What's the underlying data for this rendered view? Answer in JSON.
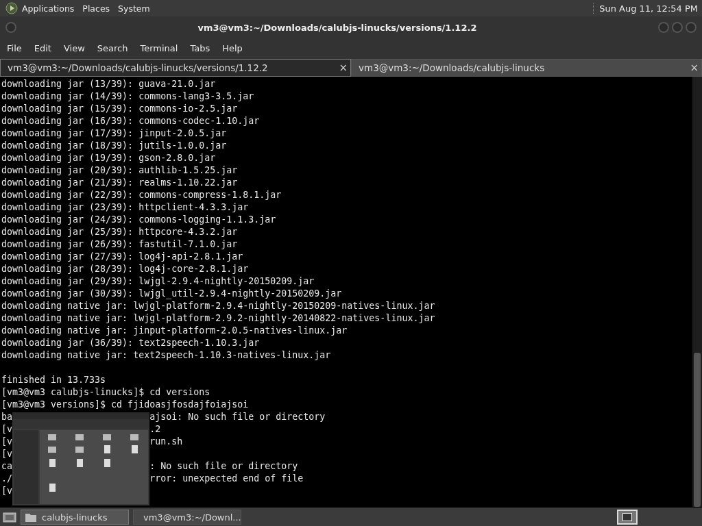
{
  "top_panel": {
    "menus": [
      "Applications",
      "Places",
      "System"
    ],
    "clock": "Sun Aug 11, 12:54 PM"
  },
  "window": {
    "title": "vm3@vm3:~/Downloads/calubjs-linucks/versions/1.12.2"
  },
  "menu_bar": [
    "File",
    "Edit",
    "View",
    "Search",
    "Terminal",
    "Tabs",
    "Help"
  ],
  "tabs": [
    {
      "label": "vm3@vm3:~/Downloads/calubjs-linucks/versions/1.12.2",
      "close": "×",
      "selected": true
    },
    {
      "label": "vm3@vm3:~/Downloads/calubjs-linucks",
      "close": "×",
      "selected": false
    }
  ],
  "terminal": {
    "lines": [
      {
        "kind": "text",
        "text": "downloading jar (13/39): guava-21.0.jar"
      },
      {
        "kind": "text",
        "text": "downloading jar (14/39): commons-lang3-3.5.jar"
      },
      {
        "kind": "text",
        "text": "downloading jar (15/39): commons-io-2.5.jar"
      },
      {
        "kind": "text",
        "text": "downloading jar (16/39): commons-codec-1.10.jar"
      },
      {
        "kind": "text",
        "text": "downloading jar (17/39): jinput-2.0.5.jar"
      },
      {
        "kind": "text",
        "text": "downloading jar (18/39): jutils-1.0.0.jar"
      },
      {
        "kind": "text",
        "text": "downloading jar (19/39): gson-2.8.0.jar"
      },
      {
        "kind": "text",
        "text": "downloading jar (20/39): authlib-1.5.25.jar"
      },
      {
        "kind": "text",
        "text": "downloading jar (21/39): realms-1.10.22.jar"
      },
      {
        "kind": "text",
        "text": "downloading jar (22/39): commons-compress-1.8.1.jar"
      },
      {
        "kind": "text",
        "text": "downloading jar (23/39): httpclient-4.3.3.jar"
      },
      {
        "kind": "text",
        "text": "downloading jar (24/39): commons-logging-1.1.3.jar"
      },
      {
        "kind": "text",
        "text": "downloading jar (25/39): httpcore-4.3.2.jar"
      },
      {
        "kind": "text",
        "text": "downloading jar (26/39): fastutil-7.1.0.jar"
      },
      {
        "kind": "text",
        "text": "downloading jar (27/39): log4j-api-2.8.1.jar"
      },
      {
        "kind": "text",
        "text": "downloading jar (28/39): log4j-core-2.8.1.jar"
      },
      {
        "kind": "text",
        "text": "downloading jar (29/39): lwjgl-2.9.4-nightly-20150209.jar"
      },
      {
        "kind": "text",
        "text": "downloading jar (30/39): lwjgl_util-2.9.4-nightly-20150209.jar"
      },
      {
        "kind": "text",
        "text": "downloading native jar: lwjgl-platform-2.9.4-nightly-20150209-natives-linux.jar"
      },
      {
        "kind": "text",
        "text": "downloading native jar: lwjgl-platform-2.9.2-nightly-20140822-natives-linux.jar"
      },
      {
        "kind": "text",
        "text": "downloading native jar: jinput-platform-2.0.5-natives-linux.jar"
      },
      {
        "kind": "text",
        "text": "downloading jar (36/39): text2speech-1.10.3.jar"
      },
      {
        "kind": "text",
        "text": "downloading native jar: text2speech-1.10.3-natives-linux.jar"
      },
      {
        "kind": "blank"
      },
      {
        "kind": "text",
        "text": "finished in 13.733s"
      },
      {
        "kind": "text",
        "text": "[vm3@vm3 calubjs-linucks]$ cd versions"
      },
      {
        "kind": "text",
        "text": "[vm3@vm3 versions]$ cd fjidoasjfosdajfoiajsoi"
      },
      {
        "kind": "split",
        "left": "ba",
        "right": "ajsoi: No such file or directory"
      },
      {
        "kind": "split",
        "left": "[v",
        "right": ".2"
      },
      {
        "kind": "split",
        "left": "[v",
        "right": "run.sh"
      },
      {
        "kind": "split",
        "left": "[v"
      },
      {
        "kind": "split",
        "left": "ca",
        "right": ": No such file or directory"
      },
      {
        "kind": "split",
        "left": "./",
        "right": "rror: unexpected end of file"
      },
      {
        "kind": "split",
        "left": "[v"
      }
    ]
  },
  "taskbar": {
    "items": [
      {
        "label": "calubjs-linucks",
        "kind": "folder",
        "selected": true
      },
      {
        "label": "vm3@vm3:~/Downl...",
        "kind": "terminal",
        "selected": false
      }
    ]
  }
}
